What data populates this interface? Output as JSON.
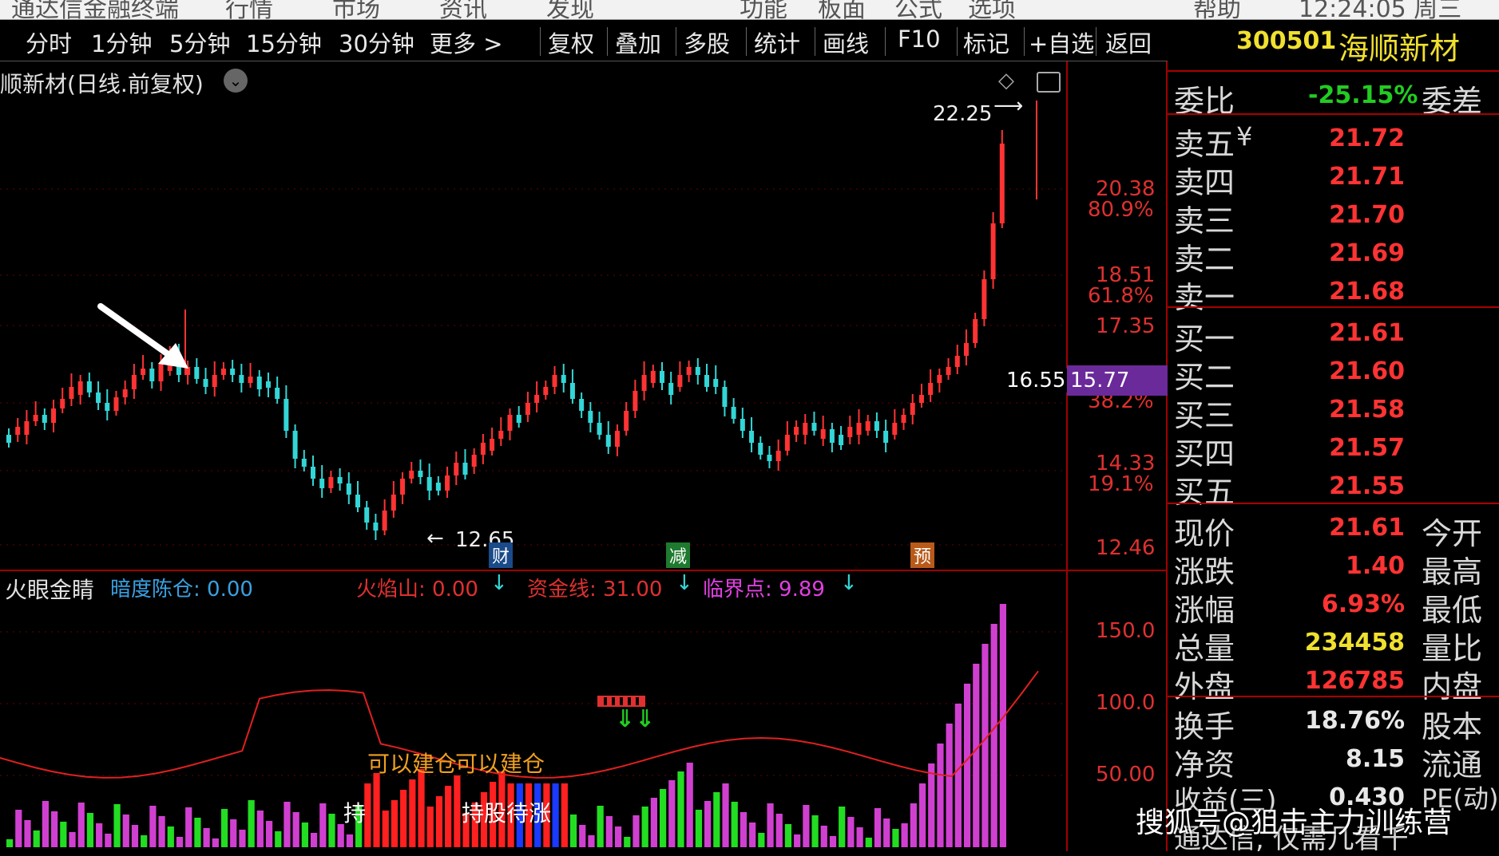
{
  "topbar": {
    "items": [
      "通达信金融终端",
      "行情",
      "市场",
      "资讯",
      "发现",
      "功能",
      "板面",
      "公式",
      "选项",
      "帮助",
      "12:24:05 周三"
    ]
  },
  "toolbar": {
    "periods": [
      "分时",
      "1分钟",
      "5分钟",
      "15分钟",
      "30分钟",
      "更多 >"
    ],
    "actions": [
      "复权",
      "叠加",
      "多股",
      "统计",
      "画线",
      "F10",
      "标记",
      "+自选",
      "返回"
    ]
  },
  "chart": {
    "title": "顺新材(日线.前复权)",
    "high_label": "22.25",
    "low_label": "12.65",
    "cursor_price": "16.55",
    "cursor_badge": "15.77",
    "event_tags": [
      "财",
      "减",
      "预"
    ],
    "price_axis": [
      "20.38",
      "80.9%",
      "18.51",
      "61.8%",
      "17.35",
      "38.2%",
      "14.33",
      "19.1%",
      "12.46"
    ]
  },
  "indicator": {
    "name": "火眼金睛",
    "line1": "暗度陈仓: 0.00",
    "line2": "火焰山: 0.00",
    "line3": "资金线: 31.00",
    "line4": "临界点: 9.89",
    "axis": [
      "150.0",
      "100.0",
      "50.00"
    ],
    "texts": [
      "可以建仓",
      "可以建仓",
      "持股待涨",
      "持"
    ]
  },
  "quote": {
    "code": "300501",
    "name": "海顺新材",
    "weibi_label": "委比",
    "weibi_value": "-25.15%",
    "weicha_label": "委差",
    "sells": [
      {
        "label": "卖五",
        "price": "21.72"
      },
      {
        "label": "卖四",
        "price": "21.71"
      },
      {
        "label": "卖三",
        "price": "21.70"
      },
      {
        "label": "卖二",
        "price": "21.69"
      },
      {
        "label": "卖一",
        "price": "21.68"
      }
    ],
    "buys": [
      {
        "label": "买一",
        "price": "21.61"
      },
      {
        "label": "买二",
        "price": "21.60"
      },
      {
        "label": "买三",
        "price": "21.58"
      },
      {
        "label": "买四",
        "price": "21.57"
      },
      {
        "label": "买五",
        "price": "21.55"
      }
    ],
    "stats": [
      {
        "label": "现价",
        "value": "21.61",
        "label2": "今开"
      },
      {
        "label": "涨跌",
        "value": "1.40",
        "label2": "最高"
      },
      {
        "label": "涨幅",
        "value": "6.93%",
        "label2": "最低"
      },
      {
        "label": "总量",
        "value": "234458",
        "label2": "量比"
      },
      {
        "label": "外盘",
        "value": "126785",
        "label2": "内盘"
      }
    ],
    "stats2": [
      {
        "label": "换手",
        "value": "18.76%",
        "label2": "股本"
      },
      {
        "label": "净资",
        "value": "8.15",
        "label2": "流通"
      },
      {
        "label": "收益(三)",
        "value": "0.430",
        "label2": "PE(动)"
      }
    ],
    "footer": "通达信, 仅需几看千"
  },
  "watermark": "搜狐号@狙击主力训练营",
  "colors": {
    "up": "#ff3333",
    "down": "#33d6d6",
    "grid": "#a00000",
    "accent_yellow": "#f0e030",
    "magenta": "#e040e0"
  }
}
